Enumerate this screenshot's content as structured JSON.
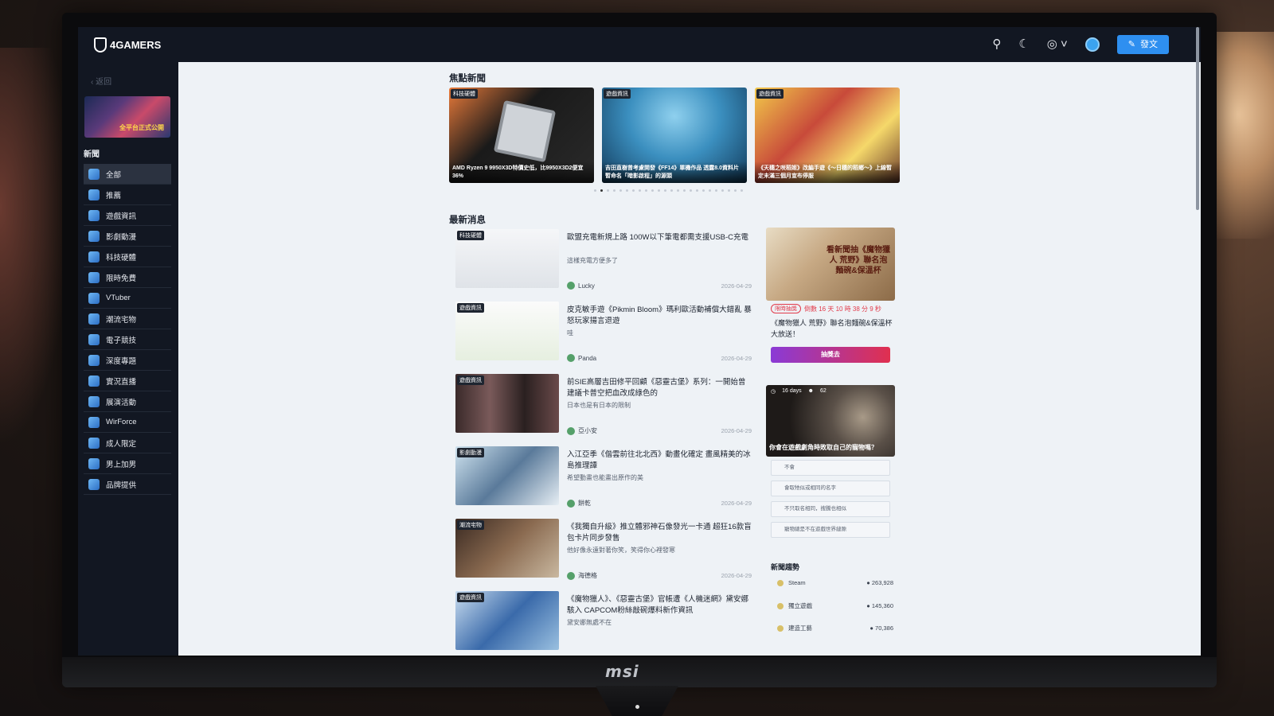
{
  "header": {
    "logo": "4GAMERS",
    "post_label": "發文"
  },
  "sidebar": {
    "back": "返回",
    "promo_text": "全平台正式公開",
    "section_title": "新聞",
    "items": [
      {
        "label": "全部",
        "active": true
      },
      {
        "label": "推薦"
      },
      {
        "label": "遊戲資訊"
      },
      {
        "label": "影劇動漫"
      },
      {
        "label": "科技硬體"
      },
      {
        "label": "限時免費"
      },
      {
        "label": "VTuber"
      },
      {
        "label": "潮流宅物"
      },
      {
        "label": "電子競技"
      },
      {
        "label": "深度專題"
      },
      {
        "label": "實況直播"
      },
      {
        "label": "展演活動"
      },
      {
        "label": "WirForce"
      },
      {
        "label": "成人限定"
      },
      {
        "label": "男上加男"
      },
      {
        "label": "品牌提供"
      }
    ]
  },
  "featured": {
    "title": "焦點新聞",
    "items": [
      {
        "tag": "科技硬體",
        "caption": "AMD Ryzen 9 9950X3D特價史低，比9950X3D2便宜36%"
      },
      {
        "tag": "遊戲資訊",
        "caption": "吉田直樹曾考慮開發《FF14》單機作品 透露8.0資料片暫命名「暗影啟程」的源頭"
      },
      {
        "tag": "遊戲資訊",
        "caption": "《天穗之咲稻姬》改編手遊《～日穗的稻鄉～》上線暫定未滿三個月宣布停服"
      }
    ]
  },
  "latest": {
    "title": "最新消息",
    "items": [
      {
        "tag": "科技硬體",
        "title": "歐盟充電新規上路 100W以下筆電都需支援USB-C充電",
        "sub": "這樣充電方便多了",
        "author": "Lucky",
        "date": "2026-04-29"
      },
      {
        "tag": "遊戲資訊",
        "title": "皮克敏手遊《Pikmin Bloom》瑪利歐活動補償大錯亂 暴怒玩家揚言退遊",
        "sub": "哇",
        "author": "Panda",
        "date": "2026-04-29"
      },
      {
        "tag": "遊戲資訊",
        "title": "前SIE高層吉田修平回顧《惡靈古堡》系列：一開始曾建議卡普空把血改成綠色的",
        "sub": "日本也是有日本的限制",
        "author": "亞小安",
        "date": "2026-04-29"
      },
      {
        "tag": "影劇動漫",
        "title": "入江亞季《偕雲前往北北西》動畫化確定 畫風精美的冰島推理譚",
        "sub": "希望動畫也能畫出原作的美",
        "author": "餅乾",
        "date": "2026-04-29"
      },
      {
        "tag": "潮流宅物",
        "title": "《我獨自升級》推立體邪神石像發光一卡通 超狂16款盲包卡片同步發售",
        "sub": "他好像永遠對著你笑，笑得你心裡發寒",
        "author": "海德格",
        "date": "2026-04-29"
      },
      {
        "tag": "遊戲資訊",
        "title": "《魔物獵人》、《惡靈古堡》官帳遭《人機迷網》黛安娜駭入 CAPCOM粉絲敲碗爆料新作資訊",
        "sub": "黛安娜無處不在",
        "author": "",
        "date": ""
      }
    ]
  },
  "ad": {
    "headline": "看新聞抽《魔物獵人 荒野》聯名泡麵碗&保溫杯",
    "badge": "限時抽獎",
    "countdown": "倒數 16 天 10 時 38 分 9 秒",
    "desc": "《魔物獵人 荒野》聯名泡麵碗&保溫杯大放送！",
    "button": "抽獎去"
  },
  "poll": {
    "days": "16 days",
    "count": "62",
    "question": "你會在遊戲劇角時敗取自己的寵物嗎？",
    "options": [
      "不會",
      "會取牠似或相同的名字",
      "不只取名相同，搜騰也相似",
      "寵物總是不在遊戲世界縫隙"
    ]
  },
  "trends": {
    "title": "新聞趨勢",
    "items": [
      {
        "name": "Steam",
        "count": "263,928"
      },
      {
        "name": "獨立遊戲",
        "count": "145,360"
      },
      {
        "name": "建造工藝",
        "count": "70,386"
      }
    ]
  }
}
